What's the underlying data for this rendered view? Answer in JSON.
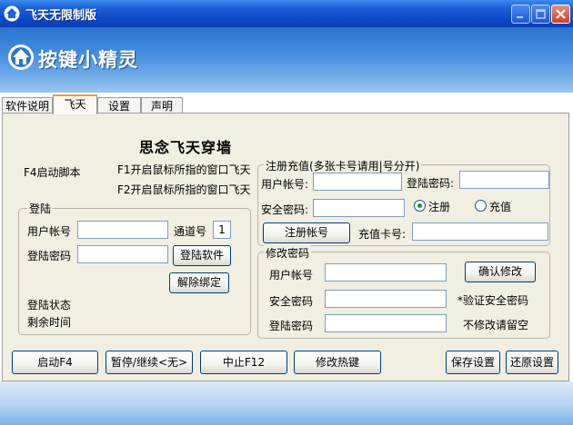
{
  "window": {
    "title": "飞天无限制版"
  },
  "banner": {
    "logo_text": "按键小精灵"
  },
  "tabs": [
    "软件说明",
    "飞天",
    "设置",
    "声明"
  ],
  "main": {
    "heading": "思念飞天穿墙",
    "f4_label": "F4启动脚本",
    "f1_label": "F1开启鼠标所指的窗口飞天",
    "f2_label": "F2开启鼠标所指的窗口飞天"
  },
  "login": {
    "legend": "登陆",
    "account_label": "用户帐号",
    "account_value": "",
    "channel_label": "通道号",
    "channel_value": "1",
    "password_label": "登陆密码",
    "password_value": "",
    "login_button": "登陆软件",
    "unbind_button": "解除绑定",
    "status_label": "登陆状态",
    "remaining_label": "剩余时间"
  },
  "register": {
    "legend": "注册充值(多张卡号请用|号分开)",
    "account_label": "用户帐号:",
    "account_value": "",
    "password_label": "登陆密码:",
    "password_value": "",
    "security_label": "安全密码:",
    "security_value": "",
    "radio_register": "注册",
    "radio_recharge": "充值",
    "register_button": "注册帐号",
    "card_label": "充值卡号:",
    "card_value": ""
  },
  "change_password": {
    "legend": "修改密码",
    "account_label": "用户帐号",
    "account_value": "",
    "confirm_button": "确认修改",
    "security_label": "安全密码",
    "security_value": "",
    "security_note": "*验证安全密码",
    "password_label": "登陆密码",
    "password_value": "",
    "password_note": "不修改请留空"
  },
  "bottom_buttons": {
    "start": "启动F4",
    "pause": "暂停/继续<无>",
    "stop": "中止F12",
    "hotkey": "修改热键",
    "save": "保存设置",
    "restore": "还原设置"
  },
  "colors": {
    "titlebar": "#0a49c8",
    "panel": "#f1efe2",
    "tab_highlight": "#f0a030",
    "radio_dot": "#1d9a1d"
  }
}
